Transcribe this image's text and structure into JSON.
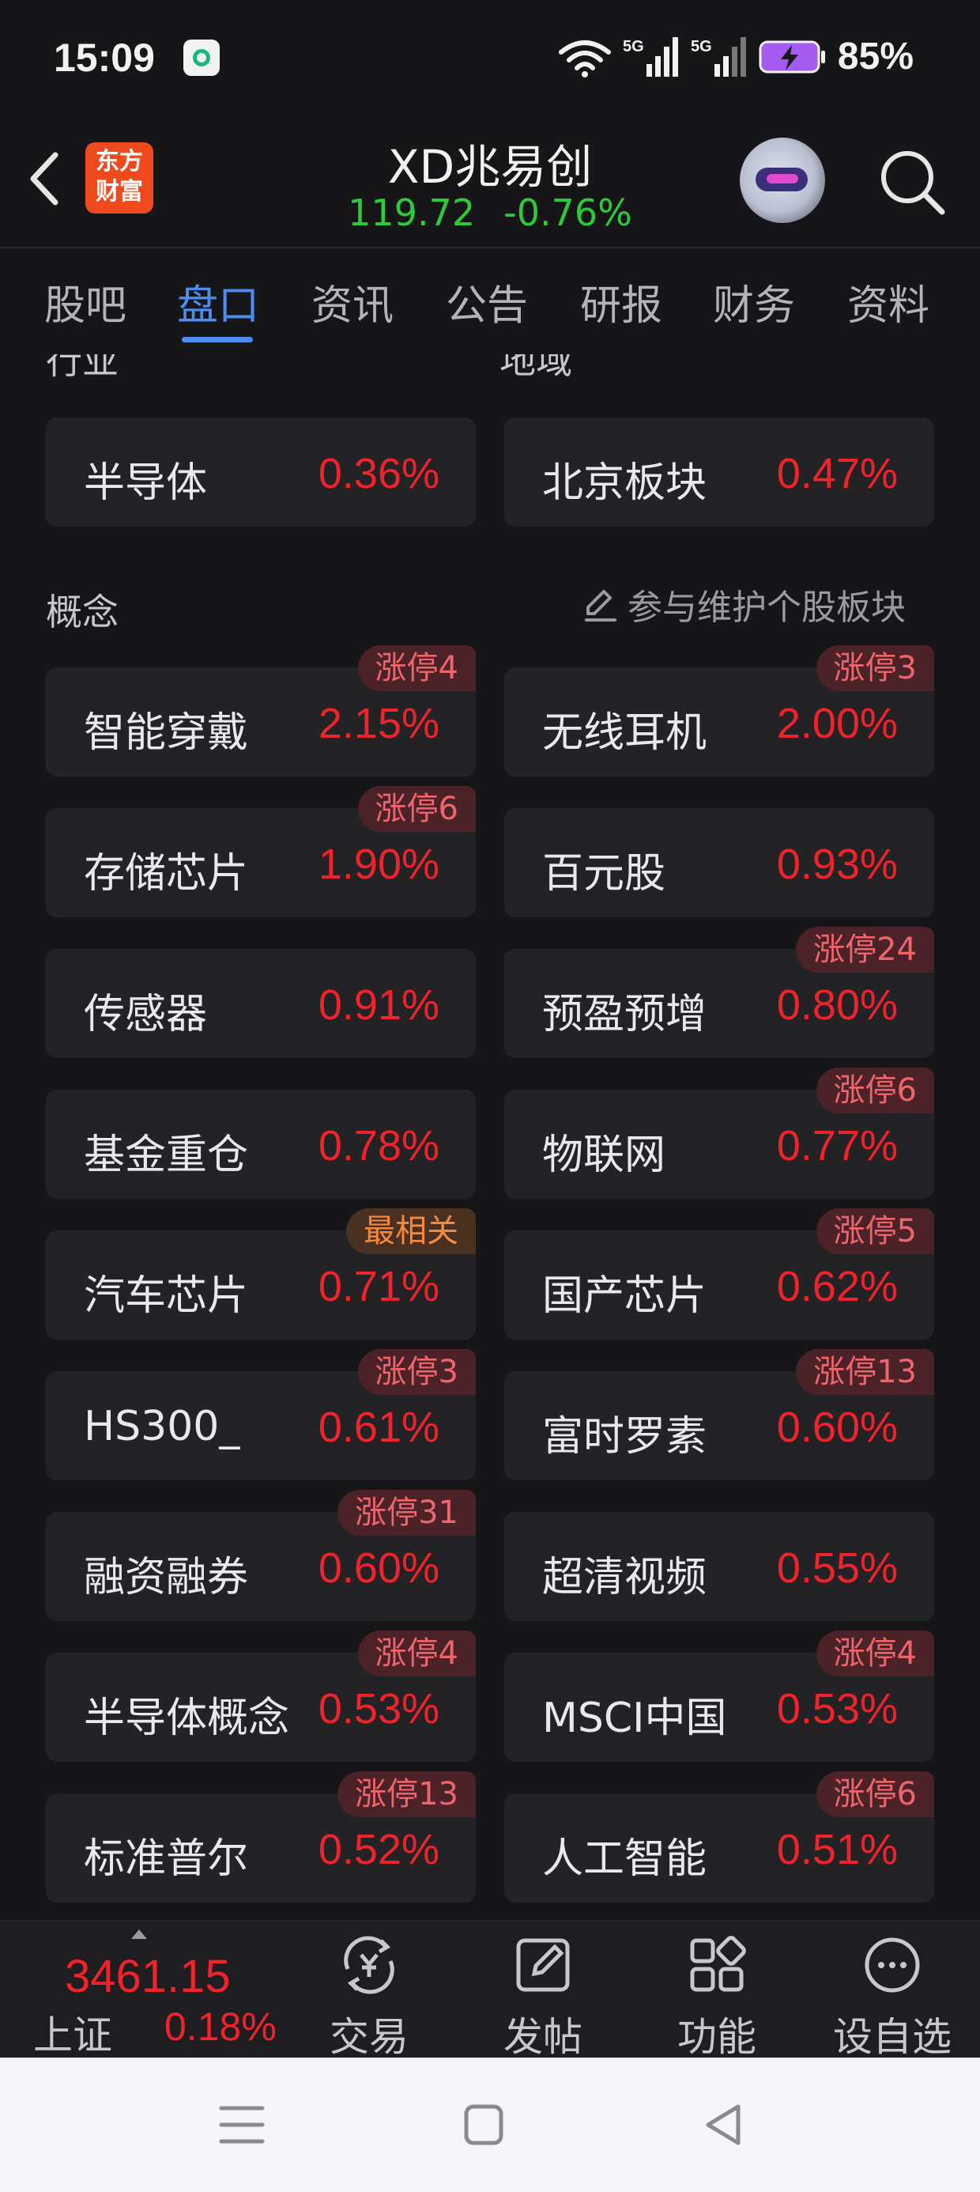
{
  "status_bar": {
    "time": "15:09",
    "battery": "85%",
    "icons": [
      "app-icon",
      "wifi-icon",
      "signal-5g-icon",
      "signal-5g-icon",
      "battery-charging-icon"
    ]
  },
  "header": {
    "logo_line1": "东方",
    "logo_line2": "财富",
    "stock_name": "XD兆易创",
    "price": "119.72",
    "change": "-0.76%"
  },
  "tabs": [
    "股吧",
    "盘口",
    "资讯",
    "公告",
    "研报",
    "财务",
    "资料"
  ],
  "active_tab": "盘口",
  "sections": {
    "industry_label": "行业",
    "region_label": "地域",
    "concept_label": "概念",
    "maintain_link": "参与维护个股板块"
  },
  "industry": {
    "name": "半导体",
    "pct": "0.36%"
  },
  "region": {
    "name": "北京板块",
    "pct": "0.47%"
  },
  "concepts": [
    {
      "name": "智能穿戴",
      "pct": "2.15%",
      "badge": "涨停4"
    },
    {
      "name": "无线耳机",
      "pct": "2.00%",
      "badge": "涨停3"
    },
    {
      "name": "存储芯片",
      "pct": "1.90%",
      "badge": "涨停6"
    },
    {
      "name": "百元股",
      "pct": "0.93%",
      "badge": ""
    },
    {
      "name": "传感器",
      "pct": "0.91%",
      "badge": ""
    },
    {
      "name": "预盈预增",
      "pct": "0.80%",
      "badge": "涨停24"
    },
    {
      "name": "基金重仓",
      "pct": "0.78%",
      "badge": ""
    },
    {
      "name": "物联网",
      "pct": "0.77%",
      "badge": "涨停6"
    },
    {
      "name": "汽车芯片",
      "pct": "0.71%",
      "badge": "最相关"
    },
    {
      "name": "国产芯片",
      "pct": "0.62%",
      "badge": "涨停5"
    },
    {
      "name": "HS300_",
      "pct": "0.61%",
      "badge": "涨停3"
    },
    {
      "name": "富时罗素",
      "pct": "0.60%",
      "badge": "涨停13"
    },
    {
      "name": "融资融券",
      "pct": "0.60%",
      "badge": "涨停31"
    },
    {
      "name": "超清视频",
      "pct": "0.55%",
      "badge": ""
    },
    {
      "name": "半导体概念",
      "pct": "0.53%",
      "badge": "涨停4"
    },
    {
      "name": "MSCI中国",
      "pct": "0.53%",
      "badge": "涨停4"
    },
    {
      "name": "标准普尔",
      "pct": "0.52%",
      "badge": "涨停13"
    },
    {
      "name": "人工智能",
      "pct": "0.51%",
      "badge": "涨停6"
    }
  ],
  "toolbar": {
    "index_value": "3461.15",
    "index_name": "上证",
    "index_pct": "0.18%",
    "trade": "交易",
    "post": "发帖",
    "functions": "功能",
    "add_watch": "设自选"
  },
  "colors": {
    "up": "#f0222b",
    "down": "#2bcc3a",
    "accent": "#4b8df0",
    "related_badge": "#f58a3c"
  }
}
